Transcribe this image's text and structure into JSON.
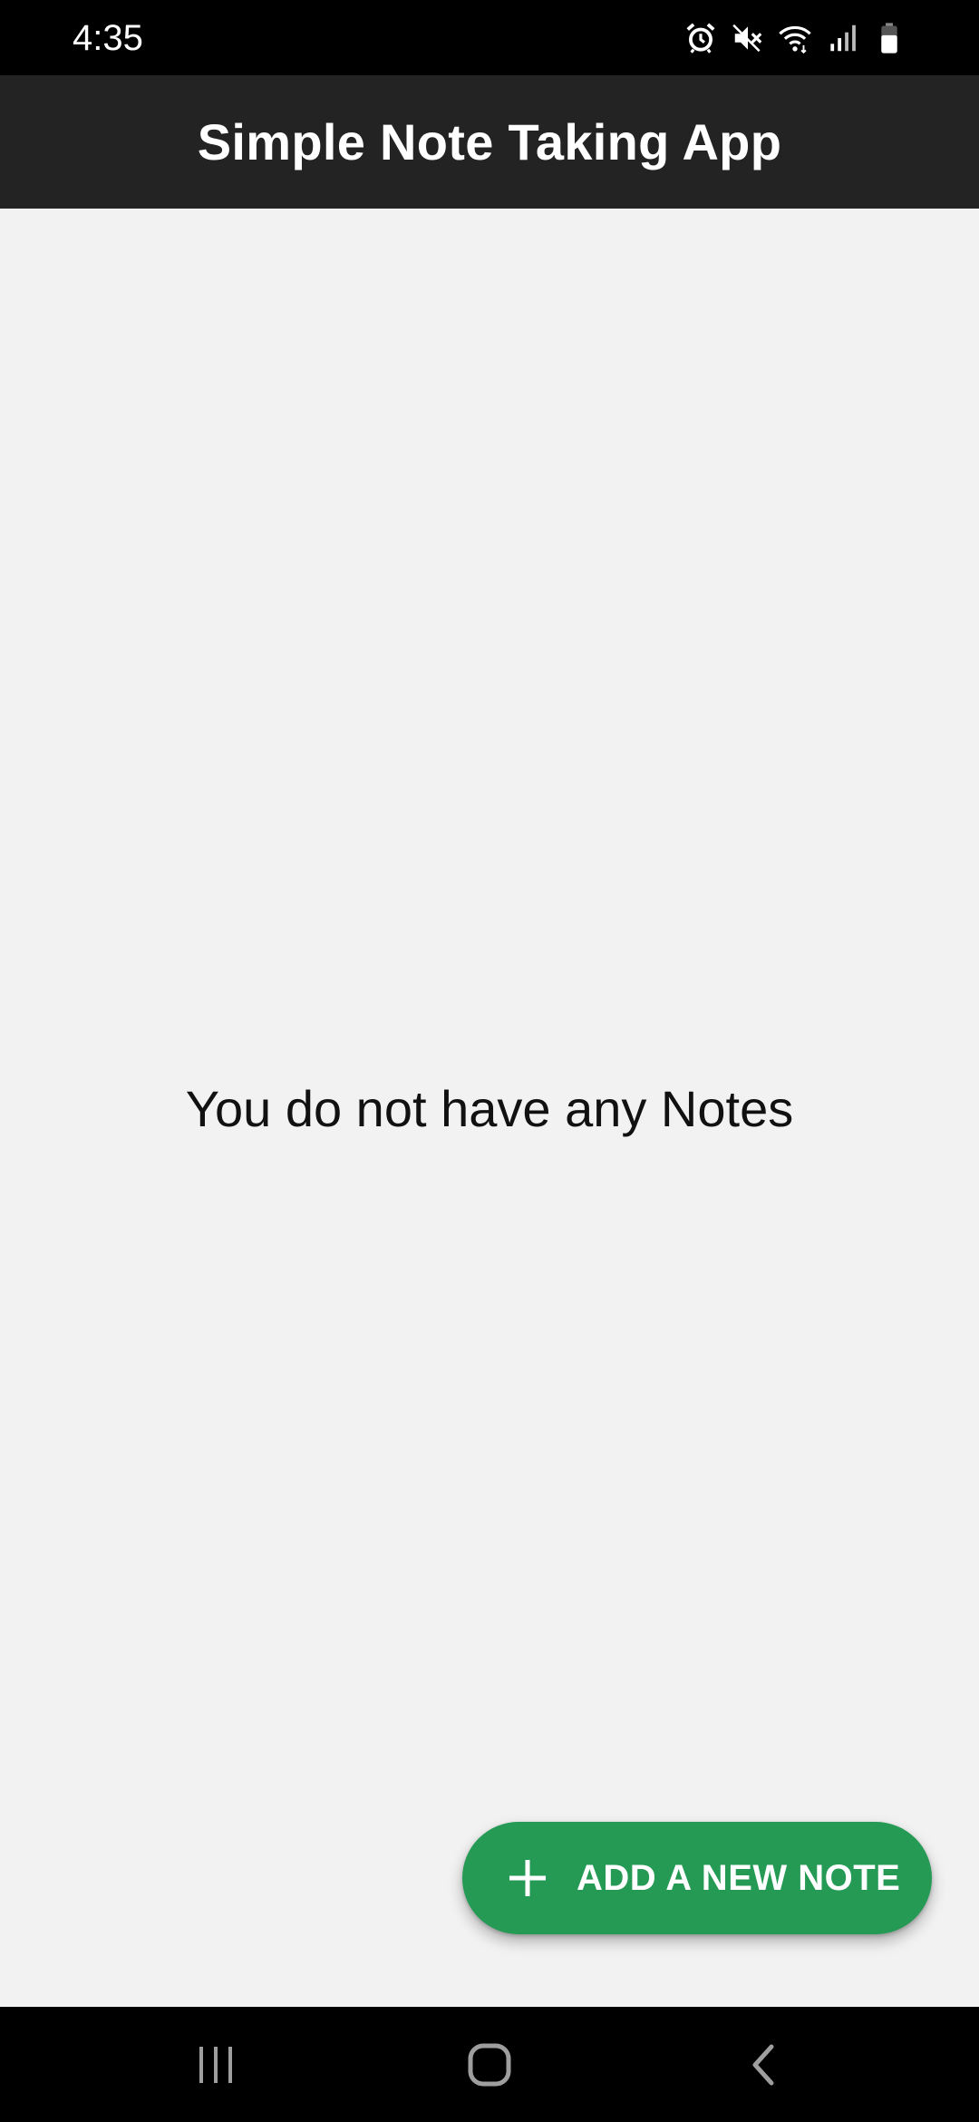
{
  "status_bar": {
    "time": "4:35",
    "icons": [
      "alarm-icon",
      "mute-icon",
      "wifi-icon",
      "signal-icon",
      "battery-icon"
    ]
  },
  "app_bar": {
    "title": "Simple Note Taking App",
    "background": "#232323"
  },
  "main": {
    "empty_message": "You do not have any Notes",
    "background": "#f2f2f2"
  },
  "fab": {
    "label": "ADD A NEW NOTE",
    "icon": "plus-icon",
    "color": "#249a55"
  },
  "nav_bar": {
    "buttons": [
      "recent-apps-icon",
      "home-icon",
      "back-icon"
    ]
  }
}
